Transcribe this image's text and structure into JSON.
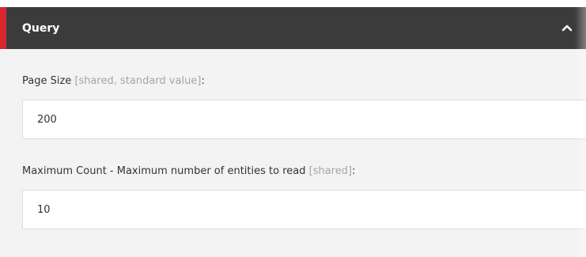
{
  "section": {
    "title": "Query",
    "collapse_icon": "chevron-up-icon",
    "accent_color": "#d8272d",
    "header_color": "#3b3b3b"
  },
  "fields": [
    {
      "label": "Page Size",
      "meta": "[shared, standard value]",
      "suffix": ":",
      "value": "200"
    },
    {
      "label": "Maximum Count - Maximum number of entities to read",
      "meta": "[shared]",
      "suffix": ":",
      "value": "10"
    }
  ]
}
